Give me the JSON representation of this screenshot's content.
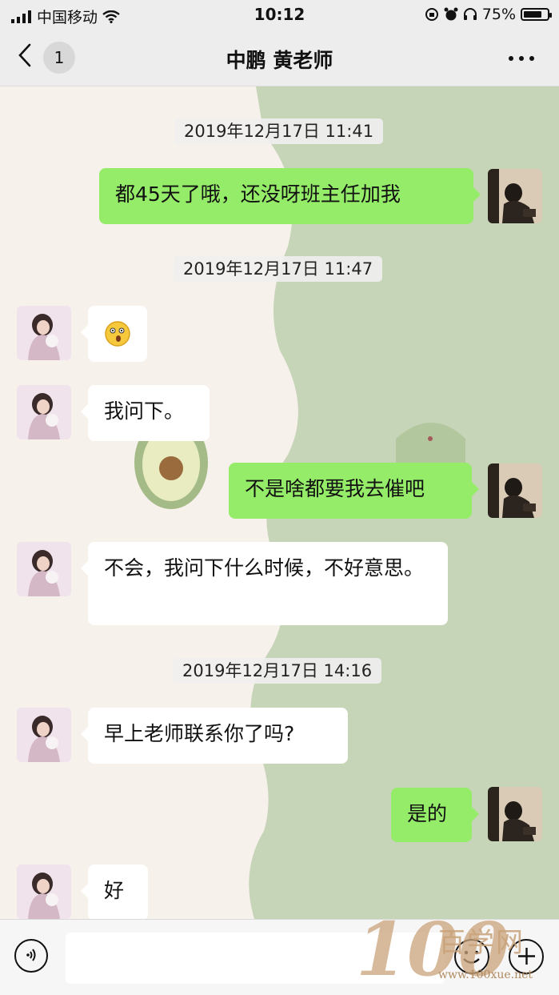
{
  "status_bar": {
    "carrier": "中国移动",
    "time": "10:12",
    "battery_percent": "75%"
  },
  "nav": {
    "back_icon": "chevron-left-icon",
    "unread_count": "1",
    "title": "中鹏  黄老师",
    "more_icon": "more-icon"
  },
  "messages": [
    {
      "type": "timestamp",
      "text": "2019年12月17日 11:41"
    },
    {
      "type": "me",
      "text": "都45天了哦，还没呀班主任加我"
    },
    {
      "type": "timestamp",
      "text": "2019年12月17日 11:47"
    },
    {
      "type": "them",
      "emoji": "surprised-emoji"
    },
    {
      "type": "them",
      "text": "我问下。"
    },
    {
      "type": "me",
      "text": "不是啥都要我去催吧"
    },
    {
      "type": "them",
      "text": "不会，我问下什么时候，不好意思。"
    },
    {
      "type": "timestamp",
      "text": "2019年12月17日 14:16"
    },
    {
      "type": "them",
      "text": "早上老师联系你了吗?"
    },
    {
      "type": "me",
      "text": "是的"
    },
    {
      "type": "them",
      "text": "好"
    }
  ],
  "input_bar": {
    "voice_icon": "voice-icon",
    "emoji_icon": "emoji-icon",
    "plus_icon": "plus-icon"
  },
  "watermark": {
    "number": "100",
    "cn": "百学网",
    "url": "www.100xue.net"
  },
  "colors": {
    "my_bubble": "#95ec69",
    "their_bubble": "#ffffff",
    "bar_bg": "#ededed",
    "chat_bg_left": "#f7f1ec",
    "chat_bg_right": "#c6d4b7"
  }
}
